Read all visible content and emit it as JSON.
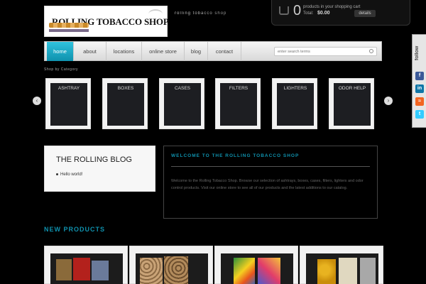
{
  "header": {
    "logo_text": "ROLLING TOBACCO SHOP",
    "tagline": "rolling tobacco shop",
    "cart": {
      "count": "0",
      "text": "products in your shopping cart",
      "total_label": "Total:",
      "total": "$0.00",
      "details_label": "details"
    }
  },
  "nav": {
    "items": [
      "home",
      "about",
      "locations",
      "online store",
      "blog",
      "contact"
    ],
    "search_placeholder": "enter search terms"
  },
  "follow": {
    "label": "follow"
  },
  "categories_title": "Shop by Category",
  "categories": [
    "ASHTRAY",
    "BOXES",
    "CASES",
    "FILTERS",
    "LIGHTERS",
    "ODOR HELP"
  ],
  "blog": {
    "title": "THE ROLLING BLOG",
    "posts": [
      "Hello world!"
    ]
  },
  "welcome": {
    "title": "WELCOME TO THE ROLLING TOBACCO SHOP",
    "text": "Welcome to the Rolling Tobacco Shop. Browse our selection of ashtrays, boxes, cases, filters, lighters and odor control products. Visit our online store to see all of our products and the latest additions to our catalog."
  },
  "new_products_title": "NEW PRODUCTS",
  "colors": {
    "accent": "#0f91ad",
    "background": "#000000"
  }
}
